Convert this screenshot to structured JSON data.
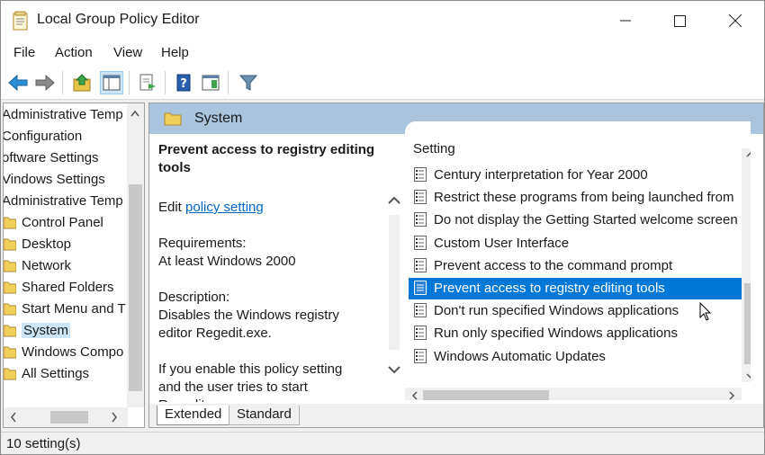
{
  "window": {
    "title": "Local Group Policy Editor"
  },
  "menu": [
    "File",
    "Action",
    "View",
    "Help"
  ],
  "tree": {
    "items": [
      {
        "label": "Administrative Temp",
        "indent": 0
      },
      {
        "label": "Configuration",
        "indent": 0
      },
      {
        "label": "oftware Settings",
        "indent": 0
      },
      {
        "label": "Vindows Settings",
        "indent": 0
      },
      {
        "label": "Administrative Temp",
        "indent": 0
      },
      {
        "label": "Control Panel",
        "indent": 1
      },
      {
        "label": "Desktop",
        "indent": 1
      },
      {
        "label": "Network",
        "indent": 1
      },
      {
        "label": "Shared Folders",
        "indent": 1
      },
      {
        "label": "Start Menu and T",
        "indent": 1
      },
      {
        "label": "System",
        "indent": 1,
        "selected": true
      },
      {
        "label": "Windows Compo",
        "indent": 1
      },
      {
        "label": "All Settings",
        "indent": 1
      }
    ]
  },
  "pane": {
    "header": "System"
  },
  "extended": {
    "title": "Prevent access to registry editing tools",
    "edit_prefix": "Edit",
    "edit_link": "policy setting",
    "requirements_label": "Requirements:",
    "requirements_value": "At least Windows 2000",
    "description_label": "Description:",
    "description_value": "Disables the Windows registry editor Regedit.exe.",
    "more_text": "If you enable this policy setting and the user tries to start Regedit..."
  },
  "settings": {
    "column_header": "Setting",
    "rows": [
      {
        "label": "Century interpretation for Year 2000"
      },
      {
        "label": "Restrict these programs from being launched from"
      },
      {
        "label": "Do not display the Getting Started welcome screen"
      },
      {
        "label": "Custom User Interface"
      },
      {
        "label": "Prevent access to the command prompt"
      },
      {
        "label": "Prevent access to registry editing tools",
        "selected": true
      },
      {
        "label": "Don't run specified Windows applications"
      },
      {
        "label": "Run only specified Windows applications"
      },
      {
        "label": "Windows Automatic Updates"
      }
    ]
  },
  "tabs": {
    "extended": "Extended",
    "standard": "Standard"
  },
  "status": {
    "text": "10 setting(s)"
  },
  "colors": {
    "selection": "#0078d7",
    "header": "#a9c4dc",
    "link": "#0066cc"
  }
}
